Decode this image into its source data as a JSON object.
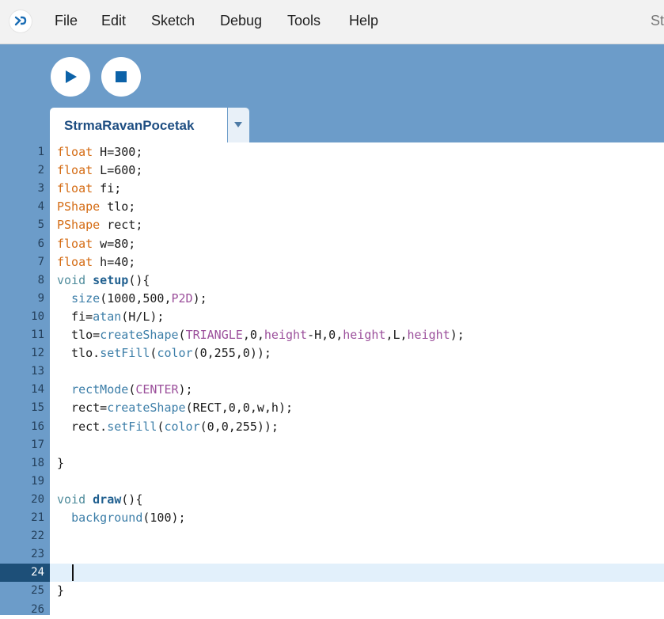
{
  "menu": {
    "items": [
      "File",
      "Edit",
      "Sketch",
      "Debug",
      "Tools",
      "Help"
    ],
    "right_truncated": "St"
  },
  "toolbar": {
    "run_icon": "play-icon",
    "stop_icon": "stop-icon"
  },
  "tab": {
    "name": "StrmaRavanPocetak",
    "dropdown_icon": "chevron-down-icon"
  },
  "editor": {
    "current_line": 24,
    "lines": [
      {
        "n": "1",
        "tokens": [
          {
            "t": "float",
            "c": "type"
          },
          {
            "t": " H=300;",
            "c": ""
          }
        ]
      },
      {
        "n": "2",
        "tokens": [
          {
            "t": "float",
            "c": "type"
          },
          {
            "t": " L=600;",
            "c": ""
          }
        ]
      },
      {
        "n": "3",
        "tokens": [
          {
            "t": "float",
            "c": "type"
          },
          {
            "t": " fi;",
            "c": ""
          }
        ]
      },
      {
        "n": "4",
        "tokens": [
          {
            "t": "PShape",
            "c": "type"
          },
          {
            "t": " tlo;",
            "c": ""
          }
        ]
      },
      {
        "n": "5",
        "tokens": [
          {
            "t": "PShape",
            "c": "type"
          },
          {
            "t": " rect;",
            "c": ""
          }
        ]
      },
      {
        "n": "6",
        "tokens": [
          {
            "t": "float",
            "c": "type"
          },
          {
            "t": " w=80;",
            "c": ""
          }
        ]
      },
      {
        "n": "7",
        "tokens": [
          {
            "t": "float",
            "c": "type"
          },
          {
            "t": " h=40;",
            "c": ""
          }
        ]
      },
      {
        "n": "8",
        "tokens": [
          {
            "t": "void",
            "c": "kw"
          },
          {
            "t": " ",
            "c": ""
          },
          {
            "t": "setup",
            "c": "fnname"
          },
          {
            "t": "(){",
            "c": ""
          }
        ]
      },
      {
        "n": "9",
        "tokens": [
          {
            "t": "  ",
            "c": ""
          },
          {
            "t": "size",
            "c": "fn"
          },
          {
            "t": "(1000,500,",
            "c": ""
          },
          {
            "t": "P2D",
            "c": "const"
          },
          {
            "t": ");",
            "c": ""
          }
        ]
      },
      {
        "n": "10",
        "tokens": [
          {
            "t": "  fi=",
            "c": ""
          },
          {
            "t": "atan",
            "c": "fn"
          },
          {
            "t": "(H/L);",
            "c": ""
          }
        ]
      },
      {
        "n": "11",
        "tokens": [
          {
            "t": "  tlo=",
            "c": ""
          },
          {
            "t": "createShape",
            "c": "fn"
          },
          {
            "t": "(",
            "c": ""
          },
          {
            "t": "TRIANGLE",
            "c": "const"
          },
          {
            "t": ",0,",
            "c": ""
          },
          {
            "t": "height",
            "c": "const"
          },
          {
            "t": "-H,0,",
            "c": ""
          },
          {
            "t": "height",
            "c": "const"
          },
          {
            "t": ",L,",
            "c": ""
          },
          {
            "t": "height",
            "c": "const"
          },
          {
            "t": ");",
            "c": ""
          }
        ]
      },
      {
        "n": "12",
        "tokens": [
          {
            "t": "  tlo.",
            "c": ""
          },
          {
            "t": "setFill",
            "c": "fn"
          },
          {
            "t": "(",
            "c": ""
          },
          {
            "t": "color",
            "c": "fn"
          },
          {
            "t": "(0,255,0));",
            "c": ""
          }
        ]
      },
      {
        "n": "13",
        "tokens": []
      },
      {
        "n": "14",
        "tokens": [
          {
            "t": "  ",
            "c": ""
          },
          {
            "t": "rectMode",
            "c": "fn"
          },
          {
            "t": "(",
            "c": ""
          },
          {
            "t": "CENTER",
            "c": "const"
          },
          {
            "t": ");",
            "c": ""
          }
        ]
      },
      {
        "n": "15",
        "tokens": [
          {
            "t": "  rect=",
            "c": ""
          },
          {
            "t": "createShape",
            "c": "fn"
          },
          {
            "t": "(RECT,0,0,w,h);",
            "c": ""
          }
        ]
      },
      {
        "n": "16",
        "tokens": [
          {
            "t": "  rect.",
            "c": ""
          },
          {
            "t": "setFill",
            "c": "fn"
          },
          {
            "t": "(",
            "c": ""
          },
          {
            "t": "color",
            "c": "fn"
          },
          {
            "t": "(0,0,255));",
            "c": ""
          }
        ]
      },
      {
        "n": "17",
        "tokens": []
      },
      {
        "n": "18",
        "tokens": [
          {
            "t": "}",
            "c": ""
          }
        ]
      },
      {
        "n": "19",
        "tokens": []
      },
      {
        "n": "20",
        "tokens": [
          {
            "t": "void",
            "c": "kw"
          },
          {
            "t": " ",
            "c": ""
          },
          {
            "t": "draw",
            "c": "fnname"
          },
          {
            "t": "(){",
            "c": ""
          }
        ]
      },
      {
        "n": "21",
        "tokens": [
          {
            "t": "  ",
            "c": ""
          },
          {
            "t": "background",
            "c": "fn"
          },
          {
            "t": "(100);",
            "c": ""
          }
        ]
      },
      {
        "n": "22",
        "tokens": []
      },
      {
        "n": "23",
        "tokens": []
      },
      {
        "n": "24",
        "tokens": []
      },
      {
        "n": "25",
        "tokens": [
          {
            "t": "}",
            "c": ""
          }
        ]
      },
      {
        "n": "26",
        "tokens": []
      }
    ]
  },
  "colors": {
    "toolbar_bg": "#6c9cc9",
    "accent": "#0c62a8",
    "current_line_gutter": "#1d4f78",
    "current_line_bg": "#e2f0fb",
    "type_keyword": "#d46b13",
    "constant": "#9b4f9b",
    "function": "#3c7ea8"
  }
}
